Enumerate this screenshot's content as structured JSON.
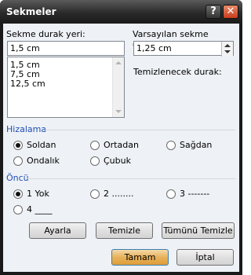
{
  "window": {
    "title": "Sekmeler",
    "help_label": "?",
    "close_label": "✕"
  },
  "tab_stop": {
    "label": "Sekme durak yeri:",
    "value": "1,5 cm",
    "list": [
      "1,5 cm",
      "7,5 cm",
      "12,5 cm"
    ]
  },
  "default_tabs": {
    "label": "Varsayılan sekme durakları:",
    "value": "1,25 cm"
  },
  "clear_label": "Temizlenecek durak:",
  "alignment": {
    "label": "Hizalama",
    "options": [
      "Soldan",
      "Ortadan",
      "Sağdan",
      "Ondalık",
      "Çubuk"
    ],
    "selected": "Soldan"
  },
  "leader": {
    "label": "Öncü",
    "options": [
      "1 Yok",
      "2 ........",
      "3 -------",
      "4 ____"
    ],
    "selected": "1 Yok"
  },
  "buttons": {
    "set": "Ayarla",
    "clear": "Temizle",
    "clear_all": "Tümünü Temizle",
    "ok": "Tamam",
    "cancel": "İptal"
  }
}
